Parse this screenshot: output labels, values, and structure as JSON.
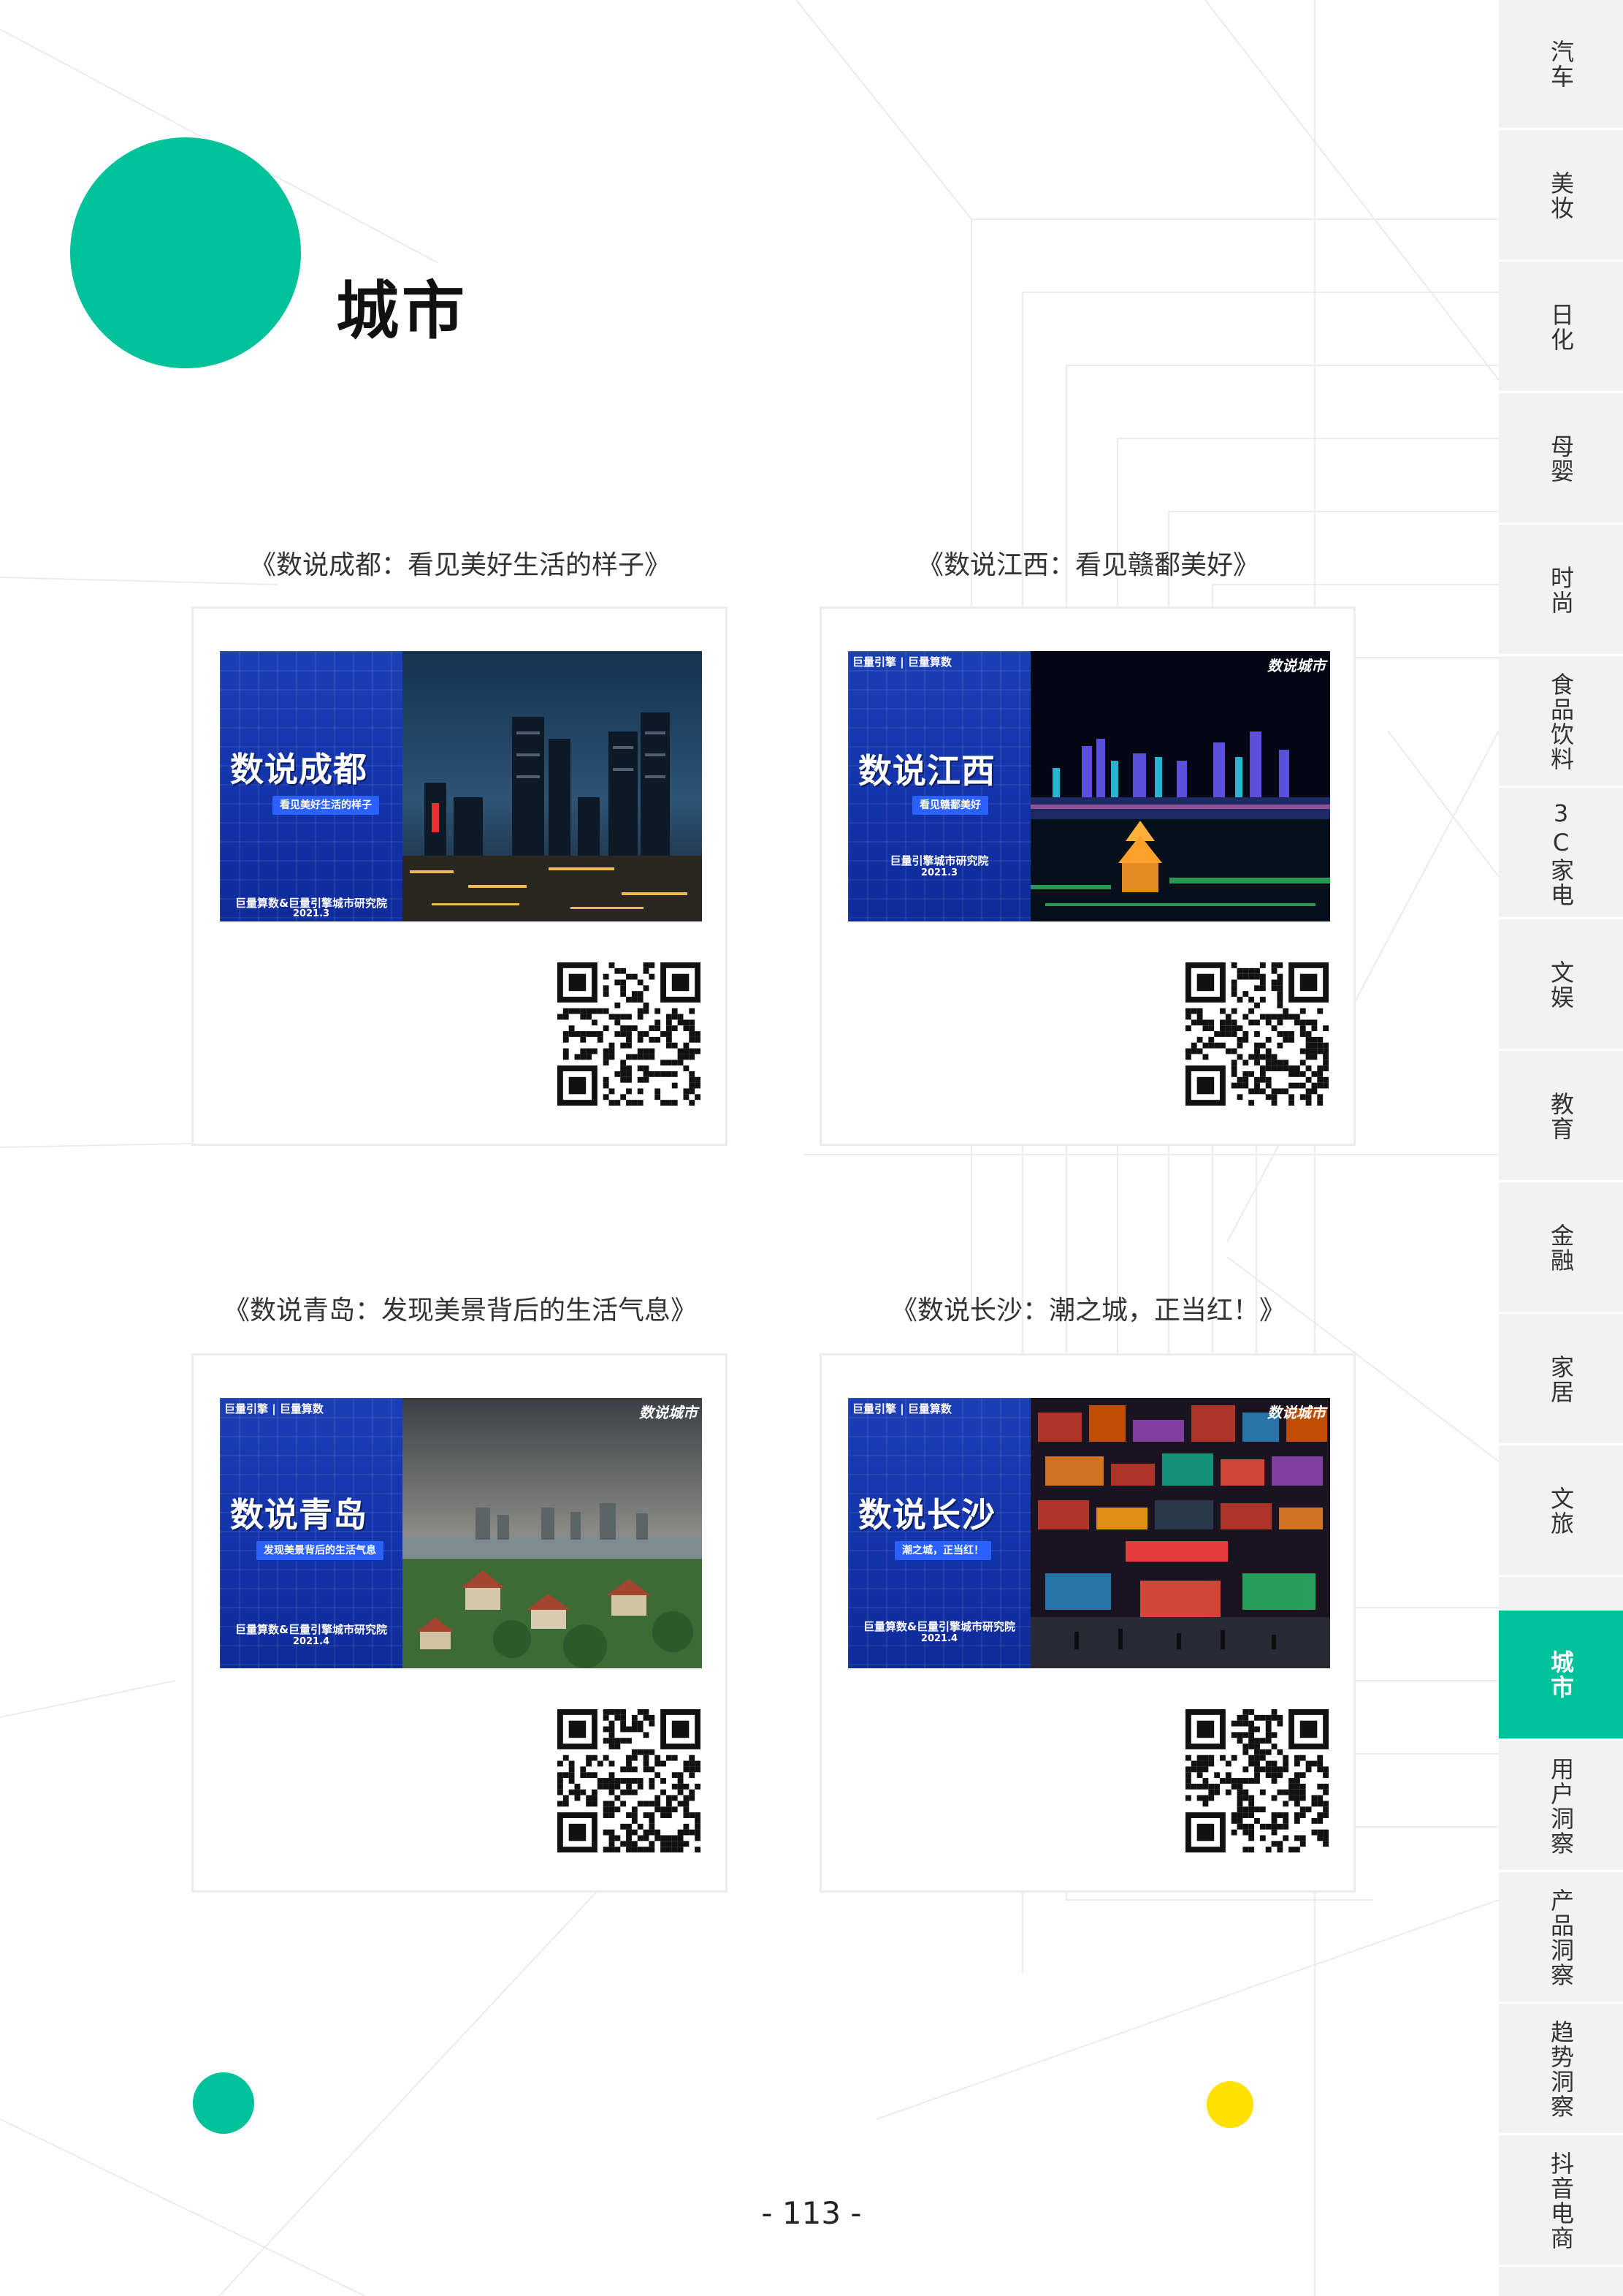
{
  "section": {
    "title": "城市"
  },
  "page_number": "- 113 -",
  "sidebar": {
    "items": [
      {
        "label": "汽车"
      },
      {
        "label": "美妆"
      },
      {
        "label": "日化"
      },
      {
        "label": "母婴"
      },
      {
        "label": "时尚"
      },
      {
        "label": "食品饮料"
      },
      {
        "label": "3C家电"
      },
      {
        "label": "文娱"
      },
      {
        "label": "教育"
      },
      {
        "label": "金融"
      },
      {
        "label": "家居"
      },
      {
        "label": "文旅"
      },
      {
        "label": "城市"
      },
      {
        "label": "用户洞察"
      },
      {
        "label": "产品洞察"
      },
      {
        "label": "趋势洞察"
      },
      {
        "label": "抖音电商"
      }
    ],
    "active_index": 12,
    "active_color": "#00c29a"
  },
  "cards": [
    {
      "caption": "《数说成都：看见美好生活的样子》",
      "thumb": {
        "brand": "",
        "corner": "",
        "title": "数说成都",
        "subtitle": "看见美好生活的样子",
        "org": "巨量算数&巨量引擎城市研究院",
        "date": "2021.3"
      }
    },
    {
      "caption": "《数说江西：看见赣鄱美好》",
      "thumb": {
        "brand": "巨量引擎 | 巨量算数",
        "corner": "数说城市",
        "title": "数说江西",
        "subtitle": "看见赣鄱美好",
        "org": "巨量引擎城市研究院",
        "date": "2021.3"
      }
    },
    {
      "caption": "《数说青岛：发现美景背后的生活气息》",
      "thumb": {
        "brand": "巨量引擎 | 巨量算数",
        "corner": "数说城市",
        "title": "数说青岛",
        "subtitle": "发现美景背后的生活气息",
        "org": "巨量算数&巨量引擎城市研究院",
        "date": "2021.4"
      }
    },
    {
      "caption": "《数说长沙：潮之城，正当红！》",
      "thumb": {
        "brand": "巨量引擎 | 巨量算数",
        "corner": "数说城市",
        "title": "数说长沙",
        "subtitle": "潮之城，正当红！",
        "org": "巨量算数&巨量引擎城市研究院",
        "date": "2021.4"
      }
    }
  ]
}
